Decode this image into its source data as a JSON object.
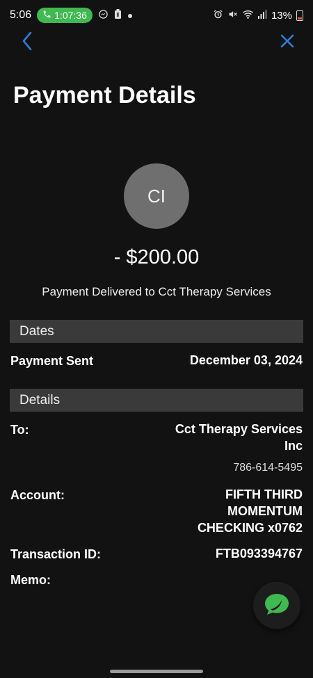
{
  "status_bar": {
    "time": "5:06",
    "call_timer": "1:07:36",
    "battery_percent": "13%",
    "icons": [
      "phone-icon",
      "messenger-icon",
      "battery-saver-icon",
      "dot-icon",
      "alarm-icon",
      "mute-icon",
      "wifi-icon",
      "signal-icon",
      "battery-icon"
    ]
  },
  "nav": {
    "back_icon": "chevron-left-icon",
    "close_icon": "close-icon",
    "accent_color": "#2f7fd6"
  },
  "page": {
    "title": "Payment Details"
  },
  "payee": {
    "initials": "CI",
    "amount": "- $200.00",
    "delivered_text": "Payment Delivered to Cct Therapy Services"
  },
  "dates": {
    "header": "Dates",
    "payment_sent_label": "Payment Sent",
    "payment_sent_value": "December 03, 2024"
  },
  "details": {
    "header": "Details",
    "to_label": "To:",
    "to_name_line1": "Cct Therapy Services",
    "to_name_line2": "Inc",
    "to_phone": "786-614-5495",
    "account_label": "Account:",
    "account_line1": "FIFTH THIRD",
    "account_line2": "MOMENTUM",
    "account_line3": "CHECKING x0762",
    "transaction_label": "Transaction ID:",
    "transaction_value": "FTB093394767",
    "memo_label": "Memo:"
  },
  "chat": {
    "icon": "chat-bubble-icon",
    "color": "#3fb950"
  }
}
